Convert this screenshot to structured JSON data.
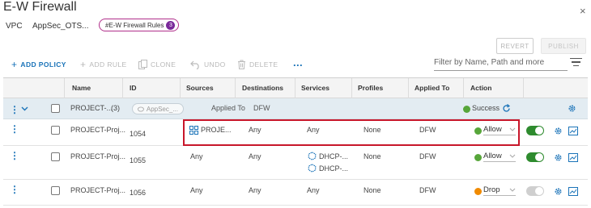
{
  "header": {
    "title": "E-W Firewall",
    "close_glyph": "×",
    "context_type": "VPC",
    "context_name": "AppSec_OTS...",
    "filter_chip_label": "#E-W Firewall Rules",
    "filter_chip_count": "3"
  },
  "actions": {
    "revert_label": "REVERT",
    "publish_label": "PUBLISH"
  },
  "toolbar": {
    "add_policy": "ADD POLICY",
    "add_rule": "ADD RULE",
    "clone": "CLONE",
    "undo": "UNDO",
    "delete": "DELETE",
    "more": "...",
    "filter_placeholder": "Filter by Name, Path and more"
  },
  "table": {
    "columns": [
      "Name",
      "ID",
      "Sources",
      "Destinations",
      "Services",
      "Profiles",
      "Applied To",
      "Action"
    ],
    "policy": {
      "name": "PROJECT-...",
      "count": "(3)",
      "source_pill": "AppSec_...",
      "applied_to_label": "Applied To",
      "applied_to_value": "DFW",
      "status": "Success"
    },
    "rows": [
      {
        "name": "PROJECT-Proj...",
        "id": "1054",
        "source": "PROJE...",
        "destination": "Any",
        "service": "Any",
        "service2": "",
        "profile": "None",
        "applied_to": "DFW",
        "action": "Allow"
      },
      {
        "name": "PROJECT-Proj...",
        "id": "1055",
        "source": "Any",
        "destination": "Any",
        "service": "DHCP-...",
        "service2": "DHCP-...",
        "profile": "None",
        "applied_to": "DFW",
        "action": "Allow"
      },
      {
        "name": "PROJECT-Proj...",
        "id": "1056",
        "source": "Any",
        "destination": "Any",
        "service": "Any",
        "service2": "",
        "profile": "None",
        "applied_to": "DFW",
        "action": "Drop"
      }
    ]
  },
  "colors": {
    "accent": "#1a73b8",
    "allow": "#57a63a",
    "drop": "#f08a00",
    "highlight": "#c8162a",
    "chip_border": "#b02f8a"
  },
  "icons": {
    "close": "close-icon",
    "add": "plus-icon",
    "clone": "clone-icon",
    "undo": "undo-icon",
    "delete": "trash-icon",
    "filter": "filter-lines-icon",
    "refresh": "refresh-icon",
    "settings": "gear-icon",
    "graph": "graph-icon",
    "group": "group-icon",
    "service": "service-icon"
  }
}
